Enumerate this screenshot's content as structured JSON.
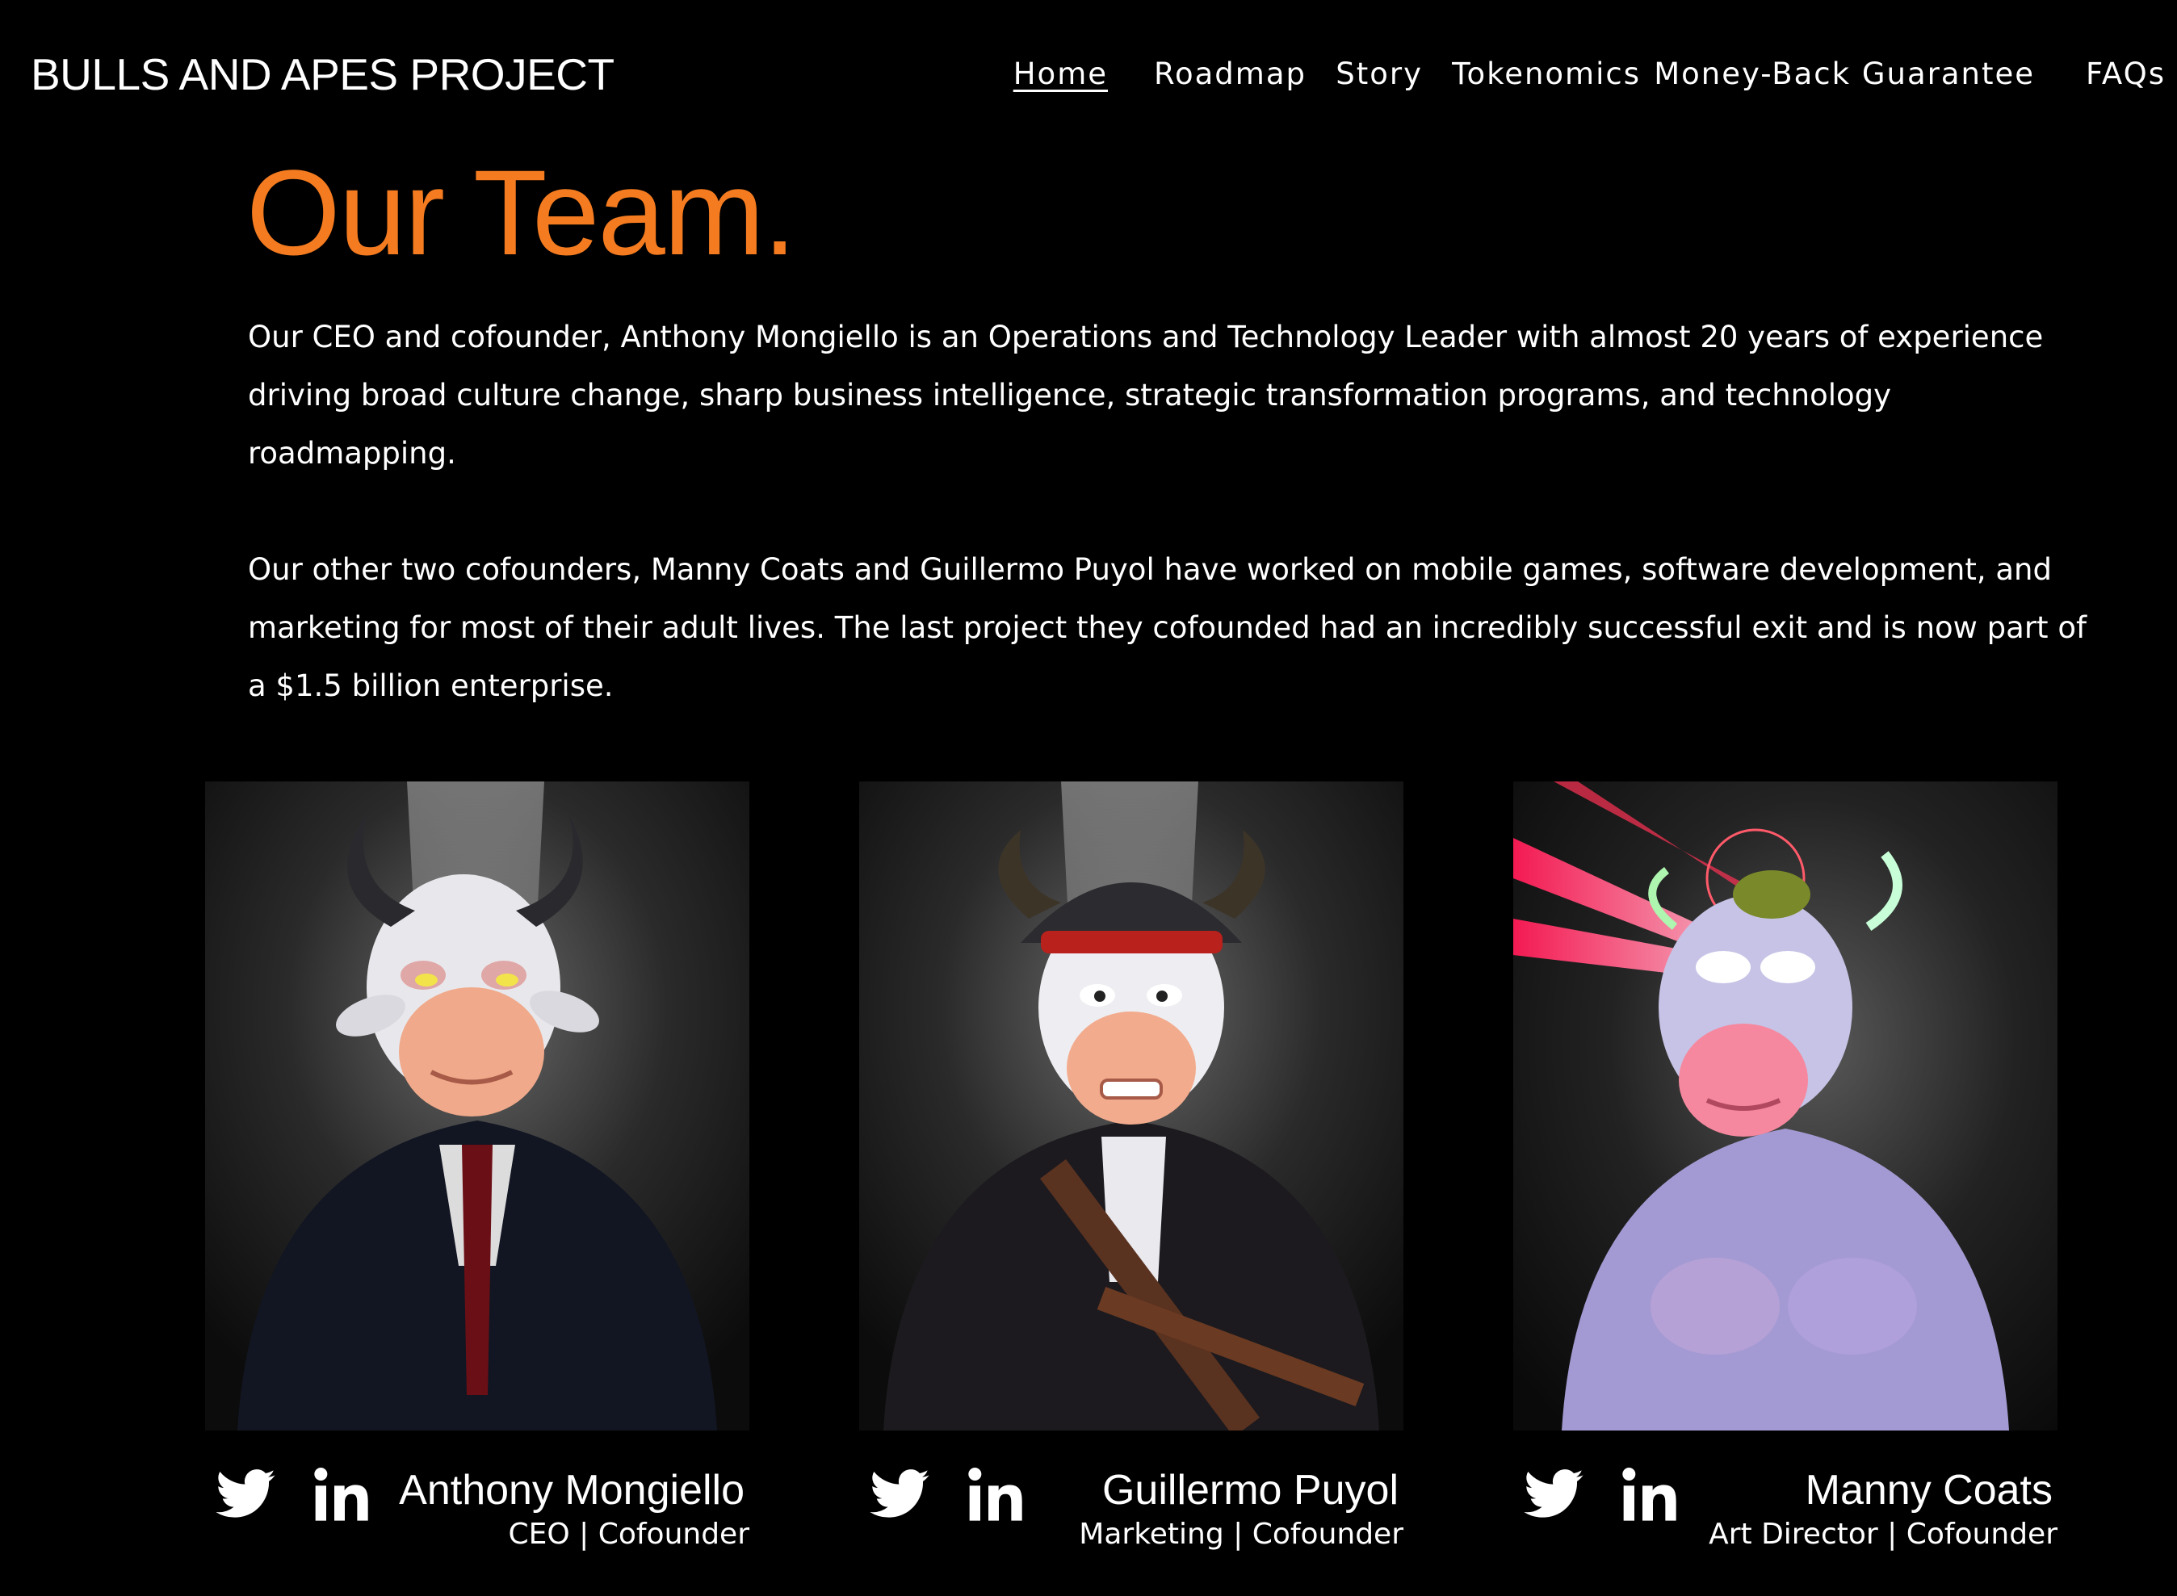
{
  "header": {
    "site_title": "BULLS AND APES PROJECT",
    "nav": [
      {
        "label": "Home",
        "active": true
      },
      {
        "label": "Roadmap",
        "active": false
      },
      {
        "label": "Story",
        "active": false
      },
      {
        "label": "Tokenomics",
        "active": false
      },
      {
        "label": "Money-Back Guarantee",
        "active": false
      },
      {
        "label": "FAQs",
        "active": false
      }
    ]
  },
  "main": {
    "heading": "Our Team.",
    "paragraphs": [
      "Our CEO and cofounder, Anthony Mongiello is an Operations and Technology Leader with almost 20 years of experience driving broad culture change, sharp business intelligence, strategic transformation programs, and technology roadmapping.",
      "Our other two cofounders, Manny Coats and Guillermo Puyol have worked on mobile games, software development, and marketing for most of their adult lives. The last project they cofounded had an incredibly successful exit and is now part of a $1.5 billion enterprise."
    ]
  },
  "team": [
    {
      "name": "Anthony Mongiello",
      "role": "CEO | Cofounder"
    },
    {
      "name": "Guillermo Puyol",
      "role": "Marketing | Cofounder"
    },
    {
      "name": "Manny Coats",
      "role": "Art Director | Cofounder"
    }
  ],
  "icons": {
    "social": [
      "twitter-icon",
      "linkedin-icon"
    ]
  },
  "colors": {
    "accent": "#f47b20",
    "background": "#000000"
  }
}
